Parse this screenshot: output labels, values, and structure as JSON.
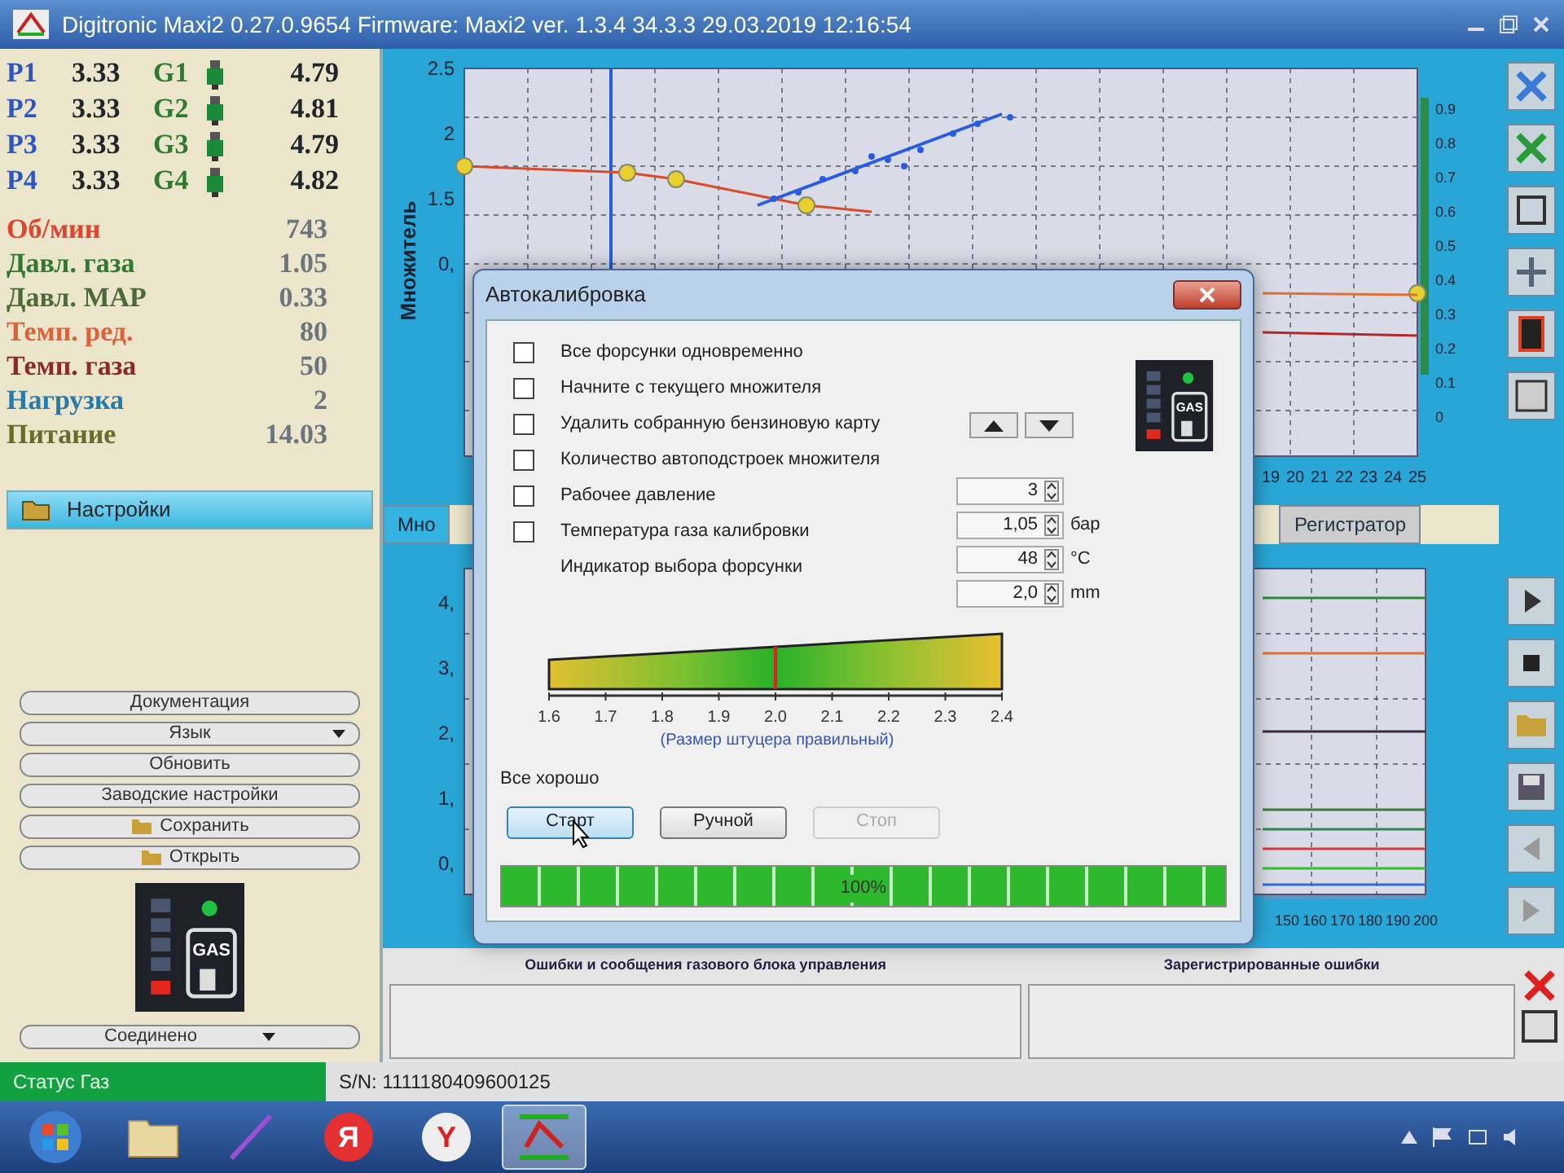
{
  "window": {
    "title": "Digitronic Maxi2 0.27.0.9654 Firmware: Maxi2 ver. 1.3.4 34.3.3 29.03.2019 12:16:54"
  },
  "injectors": [
    {
      "p_label": "P1",
      "p_value": "3.33",
      "g_label": "G1",
      "g_value": "4.79"
    },
    {
      "p_label": "P2",
      "p_value": "3.33",
      "g_label": "G2",
      "g_value": "4.81"
    },
    {
      "p_label": "P3",
      "p_value": "3.33",
      "g_label": "G3",
      "g_value": "4.79"
    },
    {
      "p_label": "P4",
      "p_value": "3.33",
      "g_label": "G4",
      "g_value": "4.82"
    }
  ],
  "parameters": [
    {
      "label": "Об/мин",
      "value": "743",
      "color": "#e0442f"
    },
    {
      "label": "Давл. газа",
      "value": "1.05",
      "color": "#2f7a2f"
    },
    {
      "label": "Давл. MAP",
      "value": "0.33",
      "color": "#4a6a3a"
    },
    {
      "label": "Темп. ред.",
      "value": "80",
      "color": "#e0603a"
    },
    {
      "label": "Темп. газа",
      "value": "50",
      "color": "#8b2a2a"
    },
    {
      "label": "Нагрузка",
      "value": "2",
      "color": "#2a7aa8"
    },
    {
      "label": "Питание",
      "value": "14.03",
      "color": "#6b6a2a"
    }
  ],
  "settings": {
    "title": "Настройки",
    "menu": [
      {
        "label": "Документация",
        "kind": "button"
      },
      {
        "label": "Язык",
        "kind": "dropdown"
      },
      {
        "label": "Обновить",
        "kind": "button"
      },
      {
        "label": "Заводские настройки",
        "kind": "button"
      },
      {
        "label": "Сохранить",
        "kind": "icon-button"
      },
      {
        "label": "Открыть",
        "kind": "icon-button"
      }
    ],
    "gas_label": "GAS",
    "connection": "Соединено"
  },
  "top_chart": {
    "y_label": "Множитель",
    "y_ticks": [
      "2.5",
      "2",
      "1.5",
      "0,"
    ],
    "x_ticks": [
      "19",
      "20",
      "21",
      "22",
      "23",
      "24",
      "25"
    ],
    "right_ticks": [
      "0.9",
      "0.8",
      "0.7",
      "0.6",
      "0.5",
      "0.4",
      "0.3",
      "0.2",
      "0.1",
      "0"
    ]
  },
  "tabs": [
    {
      "label": "Мно",
      "selected": true
    },
    {
      "label": "Регистратор",
      "selected": false
    }
  ],
  "bottom_chart": {
    "y_ticks": [
      "4,",
      "3,",
      "2,",
      "1,",
      "0,"
    ],
    "x_ticks": [
      "150",
      "160",
      "170",
      "180",
      "190",
      "200"
    ]
  },
  "errors": {
    "messages_title": "Ошибки и сообщения газового блока управления",
    "registered_title": "Зарегистрированные ошибки"
  },
  "status_bar": {
    "status": "Статус Газ",
    "serial": "S/N: 1111180409600125"
  },
  "taskbar": {
    "apps": [
      {
        "kind": "start"
      },
      {
        "kind": "folder"
      },
      {
        "kind": "pen"
      },
      {
        "kind": "letter",
        "glyph": "Я"
      },
      {
        "kind": "browser",
        "glyph": "Y"
      },
      {
        "kind": "app",
        "selected": true
      }
    ]
  },
  "dialog": {
    "title": "Автокалибровка",
    "options": [
      {
        "label": "Все форсунки одновременно",
        "checked": false
      },
      {
        "label": "Начните с текущего множителя",
        "checked": false
      },
      {
        "label": "Удалить собранную бензиновую карту",
        "checked": false
      },
      {
        "label": "Количество автоподстроек множителя",
        "checked": false
      },
      {
        "label": "Рабочее давление",
        "checked": false
      },
      {
        "label": "Температура газа калибровки",
        "checked": false
      }
    ],
    "indicator_label": "Индикатор выбора форсунки",
    "fields": [
      {
        "value": "3"
      },
      {
        "value": "1,05",
        "unit": "бар"
      },
      {
        "value": "48",
        "unit": "°C"
      },
      {
        "value": "2,0",
        "unit": "mm"
      }
    ],
    "gas_label": "GAS",
    "gauge": {
      "ticks": [
        "1.6",
        "1.7",
        "1.8",
        "1.9",
        "2.0",
        "2.1",
        "2.2",
        "2.3",
        "2.4"
      ],
      "level": 0.5,
      "caption": "(Размер штуцера правильный)"
    },
    "message": "Все хорошо",
    "buttons": [
      {
        "label": "Старт",
        "disabled": false
      },
      {
        "label": "Ручной",
        "disabled": false
      },
      {
        "label": "Стоп",
        "disabled": true
      }
    ],
    "progress": {
      "level": 1,
      "text": "100%"
    }
  }
}
